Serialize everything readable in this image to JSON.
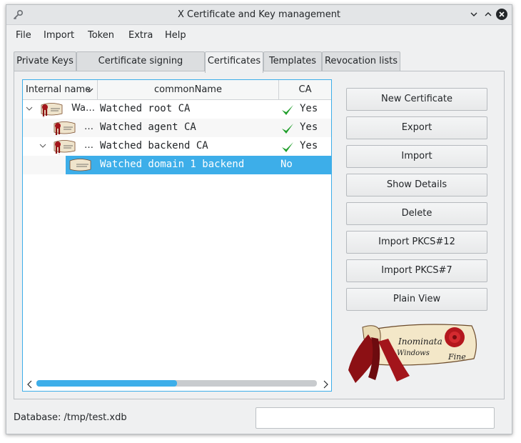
{
  "window": {
    "title": "X Certificate and Key management"
  },
  "menu": [
    "File",
    "Import",
    "Token",
    "Extra",
    "Help"
  ],
  "tabs": [
    "Private Keys",
    "Certificate signing requests",
    "Certificates",
    "Templates",
    "Revocation lists"
  ],
  "active_tab": "Certificates",
  "tree": {
    "columns": [
      "Internal name",
      "commonName",
      "CA"
    ],
    "rows": [
      {
        "internal_name": "Wa…",
        "common_name": "Watched root CA",
        "ca": "Yes",
        "ca_check": true
      },
      {
        "internal_name": "…",
        "common_name": "Watched agent CA",
        "ca": "Yes",
        "ca_check": true
      },
      {
        "internal_name": "…",
        "common_name": "Watched backend CA",
        "ca": "Yes",
        "ca_check": true
      },
      {
        "internal_name": "",
        "common_name": "Watched domain 1 backend",
        "ca": "No",
        "ca_check": false,
        "selected": true
      }
    ],
    "scroll_fraction": 0.5
  },
  "buttons": {
    "new_certificate": "New Certificate",
    "export": "Export",
    "import": "Import",
    "show_details": "Show Details",
    "delete": "Delete",
    "import_pkcs12": "Import PKCS#12",
    "import_pkcs7": "Import PKCS#7",
    "plain_view": "Plain View"
  },
  "logo_text": [
    "Inominata",
    "Windows",
    "Fine"
  ],
  "status": {
    "database": "Database: /tmp/test.xdb",
    "field_value": ""
  },
  "colors": {
    "accent": "#3daee9",
    "check": "#1f9e2a",
    "wax": "#a3151b"
  }
}
